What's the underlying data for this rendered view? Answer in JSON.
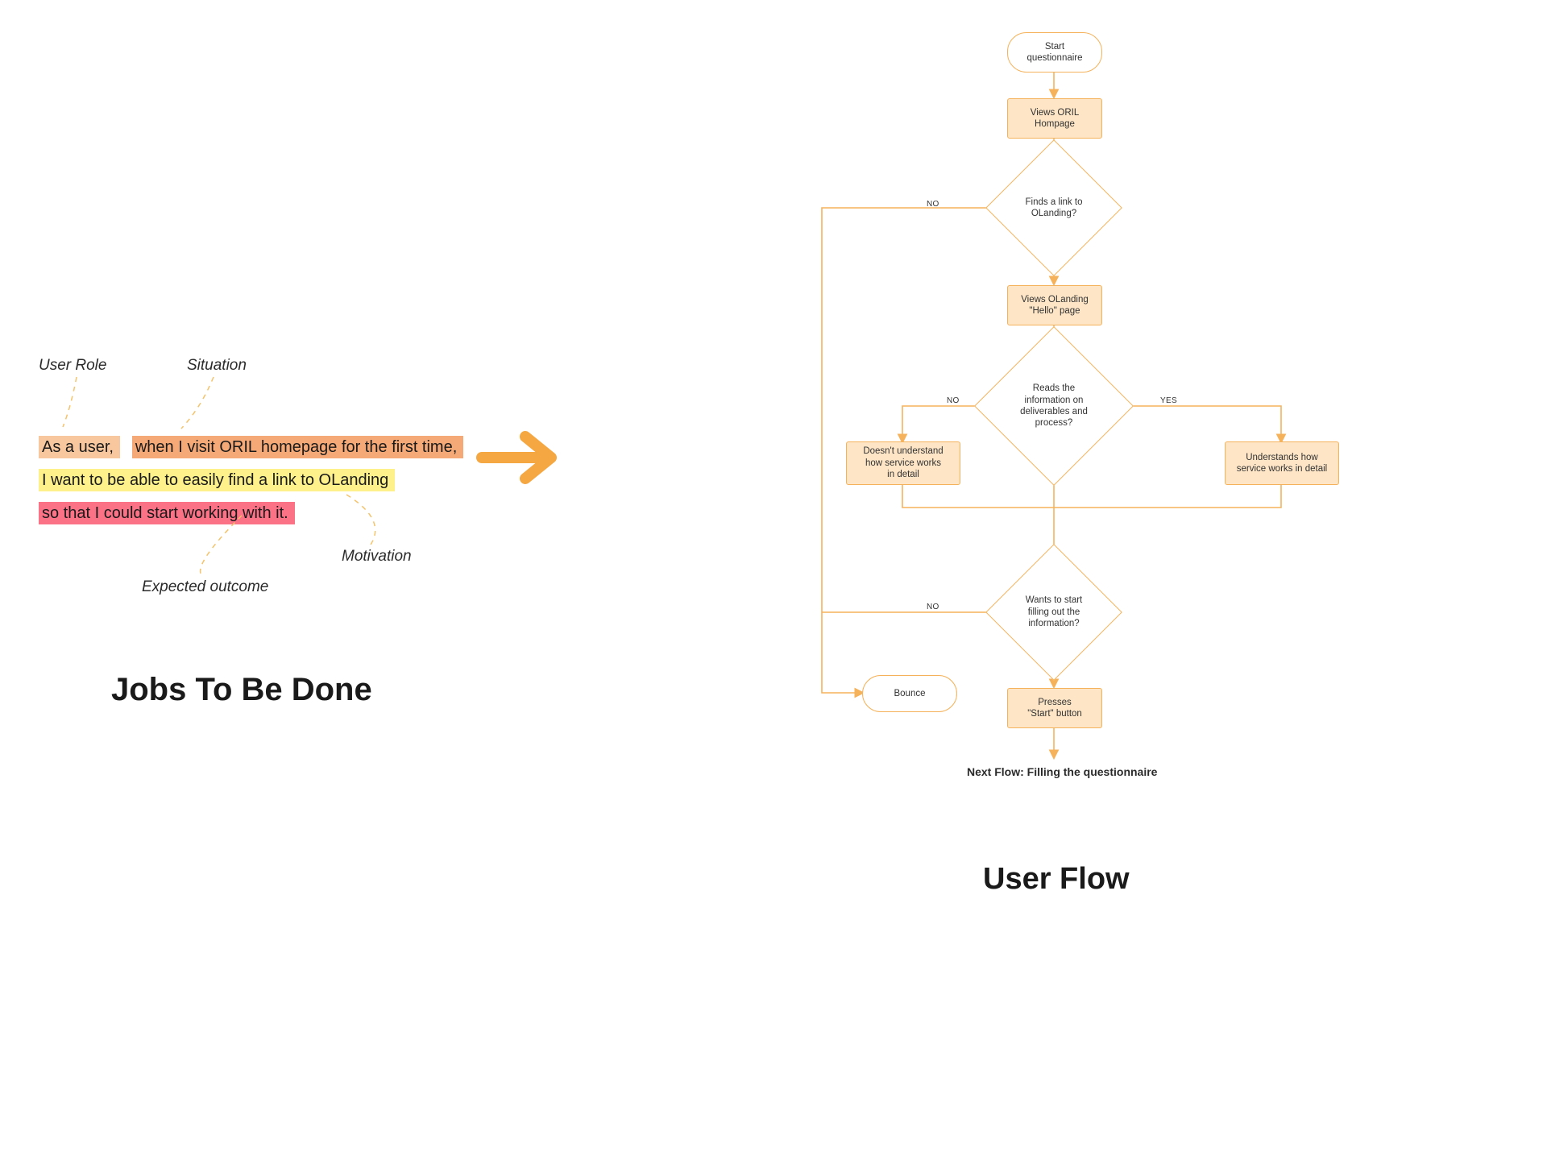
{
  "jtbd": {
    "annotations": {
      "user_role": "User Role",
      "situation": "Situation",
      "motivation": "Motivation",
      "expected_outcome": "Expected outcome"
    },
    "line1_a": "As a user,",
    "line1_b": "when I visit ORIL homepage for the first time,",
    "line2": "I want to be able to easily find a link to OLanding",
    "line3": "so that I could start working with it.",
    "title": "Jobs To Be Done"
  },
  "userflow": {
    "title": "User Flow",
    "nodes": {
      "start": "Start\nquestionnaire",
      "views_homepage": "Views ORIL\nHompage",
      "finds_link": "Finds a link to\nOLanding?",
      "views_hello": "Views OLanding\n\"Hello\" page",
      "reads_info": "Reads the\ninformation on\ndeliverables and\nprocess?",
      "doesnt_understand": "Doesn't understand\nhow service works\nin detail",
      "understands": "Understands how\nservice works in detail",
      "wants_start": "Wants to start\nfilling out the\ninformation?",
      "bounce": "Bounce",
      "presses_start": "Presses\n\"Start\" button"
    },
    "edge_labels": {
      "no": "NO",
      "yes": "YES"
    },
    "next_flow": "Next Flow: Filling the questionnaire"
  }
}
